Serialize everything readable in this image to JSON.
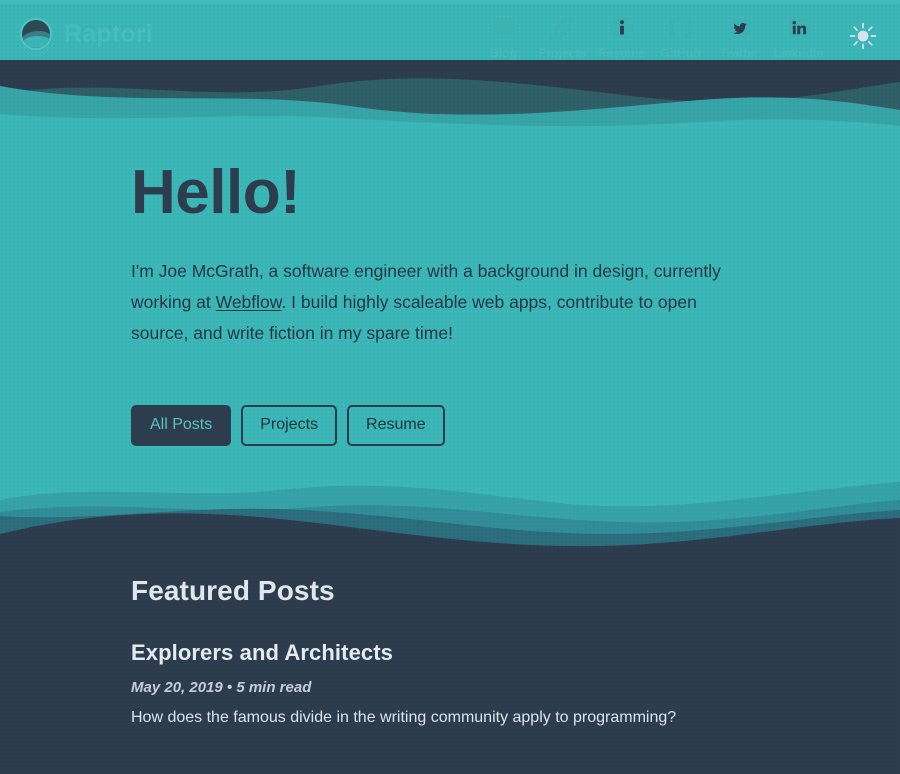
{
  "theme": {
    "accent_teal": "#3fbdbd",
    "hero_teal": "#3cb7b7",
    "dark_navy": "#2e3d4d",
    "nav_label": "#45b9bb",
    "light_text": "#dfe6ee"
  },
  "header": {
    "brand_name": "Raptori",
    "logo_icon": "circle-wave-logo-icon",
    "nav": [
      {
        "label": "Blog",
        "icon": "speech-bubble-icon"
      },
      {
        "label": "Projects",
        "icon": "rocket-icon"
      },
      {
        "label": "Resume",
        "icon": "info-circle-icon"
      },
      {
        "label": "GitHub",
        "icon": "github-icon"
      },
      {
        "label": "Twitter",
        "icon": "twitter-icon"
      },
      {
        "label": "LinkedIn",
        "icon": "linkedin-icon"
      }
    ],
    "theme_toggle_icon": "sun-icon"
  },
  "hero": {
    "title": "Hello!",
    "intro_part1": "I'm Joe McGrath, a software engineer with a background in design, currently working at ",
    "intro_link": "Webflow",
    "intro_part2": ". I build highly scaleable web apps, contribute to open source, and write fiction in my spare time!",
    "buttons": [
      {
        "label": "All Posts",
        "style": "primary"
      },
      {
        "label": "Projects",
        "style": "outline"
      },
      {
        "label": "Resume",
        "style": "outline"
      }
    ]
  },
  "featured": {
    "heading": "Featured Posts",
    "posts": [
      {
        "title": "Explorers and Architects",
        "date": "May 20, 2019",
        "separator": "•",
        "read_time": "5 min read",
        "meta": "May 20, 2019 • 5 min read",
        "description": "How does the famous divide in the writing community apply to programming?"
      }
    ]
  }
}
